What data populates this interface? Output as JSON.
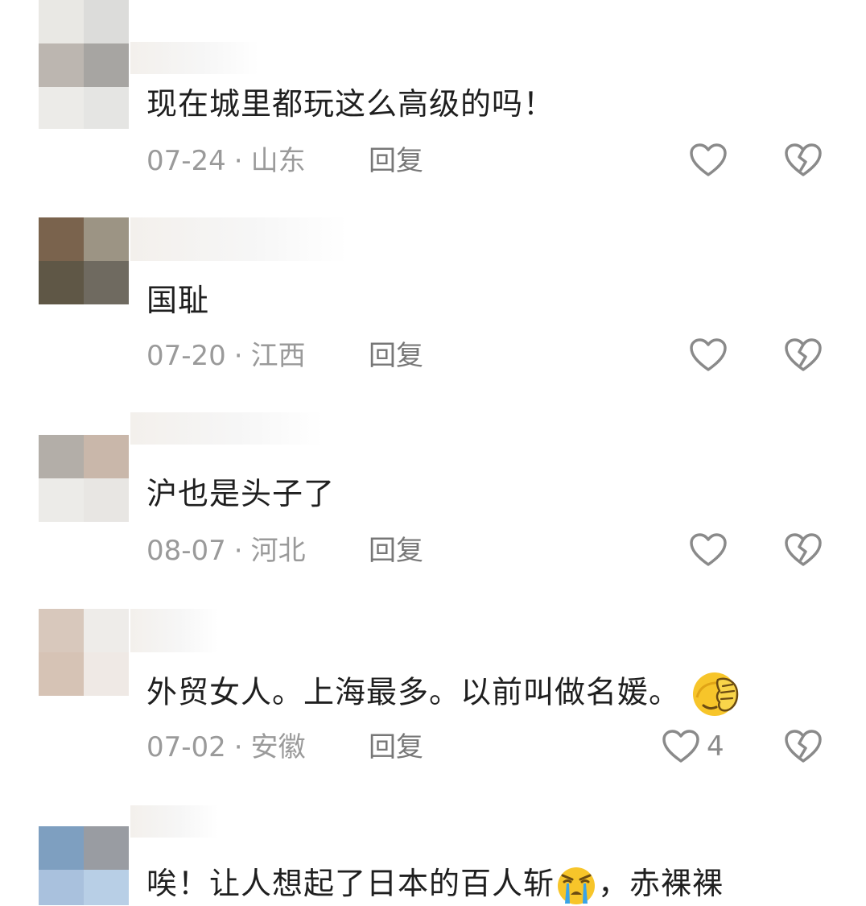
{
  "comments": [
    {
      "text": "现在城里都玩这么高级的吗！",
      "date": "07-24",
      "location": "山东",
      "reply_label": "回复",
      "likes": ""
    },
    {
      "text": "国耻",
      "date": "07-20",
      "location": "江西",
      "reply_label": "回复",
      "likes": ""
    },
    {
      "text": "沪也是头子了",
      "date": "08-07",
      "location": "河北",
      "reply_label": "回复",
      "likes": ""
    },
    {
      "text": "外贸女人。上海最多。以前叫做名媛。",
      "emoji": "face-palm-emoji",
      "date": "07-02",
      "location": "安徽",
      "reply_label": "回复",
      "likes": "4"
    },
    {
      "text_before": "唉！让人想起了日本的百人斩",
      "emoji": "loudly-crying-emoji",
      "text_after": "，赤裸裸"
    }
  ],
  "separator": "·",
  "colors": {
    "text": "#1f1f1f",
    "meta": "#9a9a9a",
    "icon": "#8a8a8a"
  },
  "icons": [
    "heart-outline-icon",
    "broken-heart-icon"
  ]
}
